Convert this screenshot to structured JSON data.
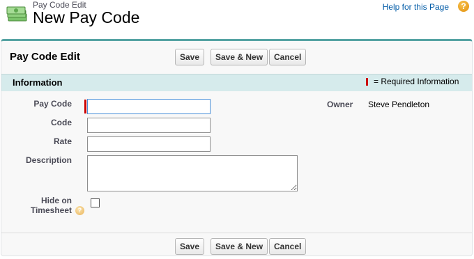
{
  "header": {
    "subtitle": "Pay Code Edit",
    "title": "New Pay Code",
    "help_link": "Help for this Page",
    "help_icon": "?"
  },
  "panel": {
    "title": "Pay Code Edit",
    "buttons": {
      "save": "Save",
      "save_new": "Save & New",
      "cancel": "Cancel"
    }
  },
  "section": {
    "title": "Information",
    "required_legend": "= Required Information"
  },
  "form": {
    "pay_code": {
      "label": "Pay Code",
      "value": ""
    },
    "code": {
      "label": "Code",
      "value": ""
    },
    "rate": {
      "label": "Rate",
      "value": ""
    },
    "description": {
      "label": "Description",
      "value": ""
    },
    "hide_on_timesheet": {
      "label_line1": "Hide on",
      "label_line2": "Timesheet",
      "checked": false,
      "info_icon": "?"
    },
    "owner": {
      "label": "Owner",
      "value": "Steve Pendleton"
    }
  },
  "colors": {
    "accent": "#56a3a3",
    "section_bg": "#d6ebec",
    "required": "#cc0000",
    "link": "#015ba7"
  }
}
